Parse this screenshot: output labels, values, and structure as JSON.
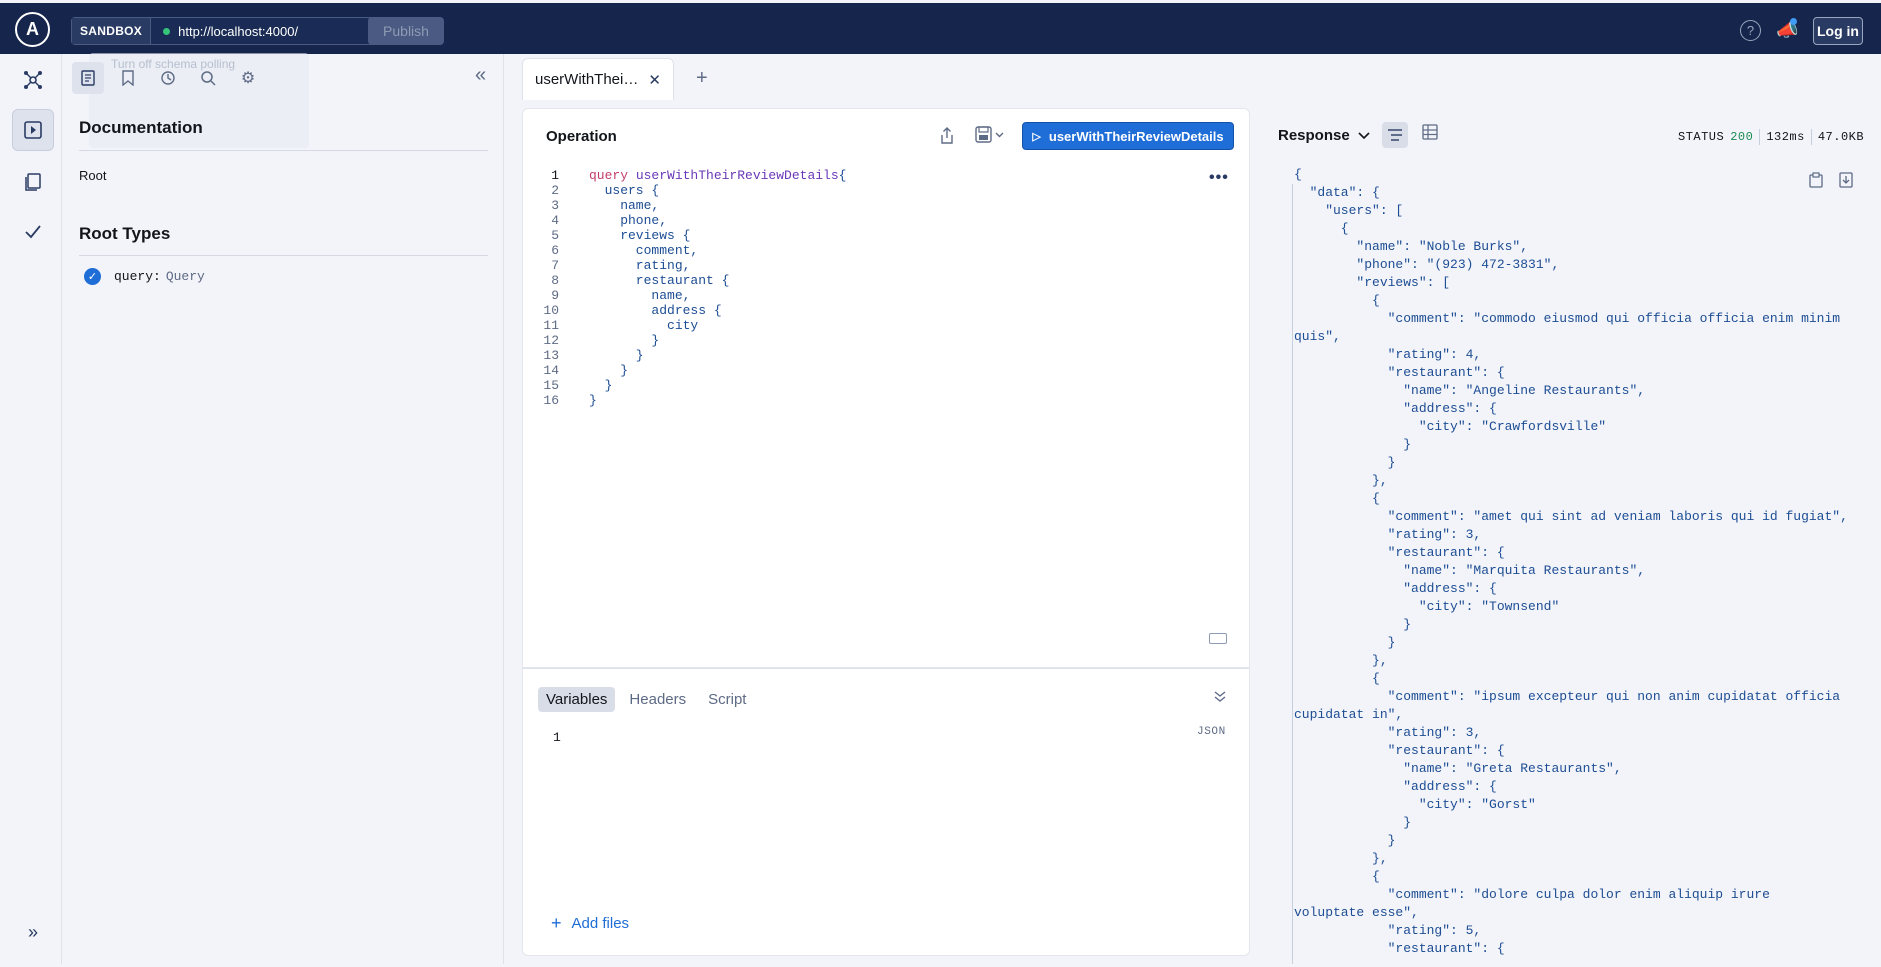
{
  "topbar": {
    "logo": "A",
    "sandbox_label": "SANDBOX",
    "url": "http://localhost:4000/",
    "publish_label": "Publish",
    "help_label": "?",
    "login_label": "Log in",
    "tooltip_line1": "Turn off schema polling"
  },
  "docs": {
    "title": "Documentation",
    "root": "Root",
    "root_types_title": "Root Types",
    "query_field": "query:",
    "query_type": "Query"
  },
  "tabs": [
    {
      "label": "userWithThei…"
    }
  ],
  "operation": {
    "title": "Operation",
    "run_label": "userWithTheirReviewDetails",
    "lines": [
      "query userWithTheirReviewDetails{",
      "  users {",
      "    name,",
      "    phone,",
      "    reviews {",
      "      comment,",
      "      rating,",
      "      restaurant {",
      "        name,",
      "        address {",
      "          city",
      "        }",
      "      }",
      "    }",
      "  }",
      "}"
    ]
  },
  "variables": {
    "tabs": [
      "Variables",
      "Headers",
      "Script"
    ],
    "json_label": "JSON",
    "line_number": "1",
    "add_files": "Add files"
  },
  "response": {
    "title": "Response",
    "status_label": "STATUS",
    "status_code": "200",
    "time": "132ms",
    "size": "47.0KB",
    "lines": [
      "{",
      "  \"data\": {",
      "    \"users\": [",
      "      {",
      "        \"name\": \"Noble Burks\",",
      "        \"phone\": \"(923) 472-3831\",",
      "        \"reviews\": [",
      "          {",
      "            \"comment\": \"commodo eiusmod qui officia officia enim minim",
      "quis\",",
      "            \"rating\": 4,",
      "            \"restaurant\": {",
      "              \"name\": \"Angeline Restaurants\",",
      "              \"address\": {",
      "                \"city\": \"Crawfordsville\"",
      "              }",
      "            }",
      "          },",
      "          {",
      "            \"comment\": \"amet qui sint ad veniam laboris qui id fugiat\",",
      "            \"rating\": 3,",
      "            \"restaurant\": {",
      "              \"name\": \"Marquita Restaurants\",",
      "              \"address\": {",
      "                \"city\": \"Townsend\"",
      "              }",
      "            }",
      "          },",
      "          {",
      "            \"comment\": \"ipsum excepteur qui non anim cupidatat officia",
      "cupidatat in\",",
      "            \"rating\": 3,",
      "            \"restaurant\": {",
      "              \"name\": \"Greta Restaurants\",",
      "              \"address\": {",
      "                \"city\": \"Gorst\"",
      "              }",
      "            }",
      "          },",
      "          {",
      "            \"comment\": \"dolore culpa dolor enim aliquip irure",
      "voluptate esse\",",
      "            \"rating\": 5,",
      "            \"restaurant\": {"
    ]
  }
}
